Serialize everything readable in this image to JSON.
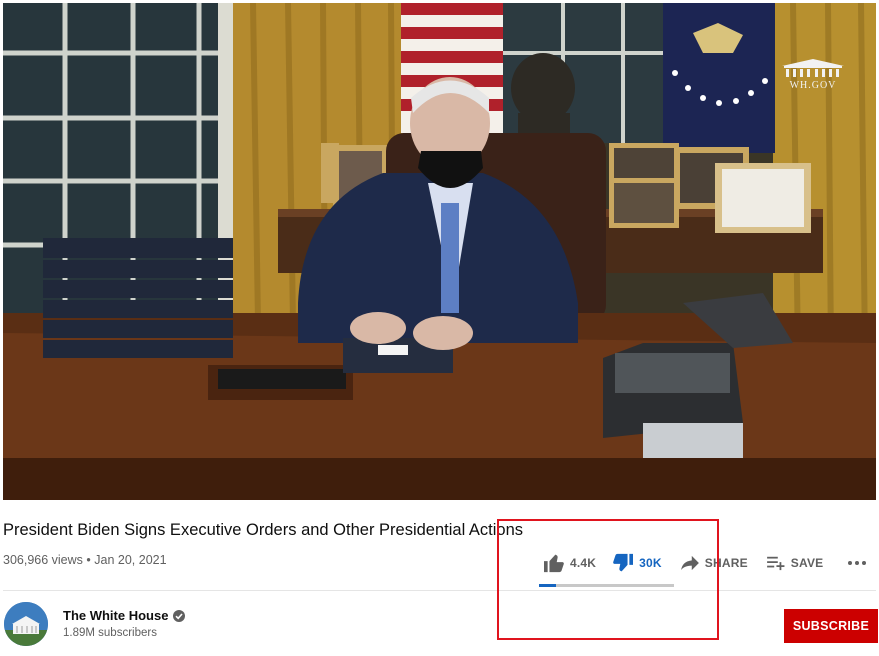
{
  "video": {
    "watermark": "WH.GOV"
  },
  "title": "President Biden Signs Executive Orders and Other Presidential Actions",
  "meta": {
    "views": "306,966 views",
    "separator": "•",
    "date": "Jan 20, 2021"
  },
  "actions": {
    "like_count": "4.4K",
    "dislike_count": "30K",
    "share_label": "SHARE",
    "save_label": "SAVE",
    "more_icon": "more-horizontal-icon",
    "like_icon": "thumbs-up-icon",
    "dislike_icon": "thumbs-down-icon",
    "share_icon": "share-arrow-icon",
    "save_icon": "playlist-add-icon",
    "like_ratio": 0.128
  },
  "channel": {
    "name": "The White House",
    "subscribers": "1.89M subscribers",
    "verified_icon": "verified-check-icon"
  },
  "subscribe_label": "SUBSCRIBE",
  "colors": {
    "accent_blue": "#1565c0",
    "subscribe_red": "#cc0000",
    "highlight_red": "#e0141e"
  }
}
